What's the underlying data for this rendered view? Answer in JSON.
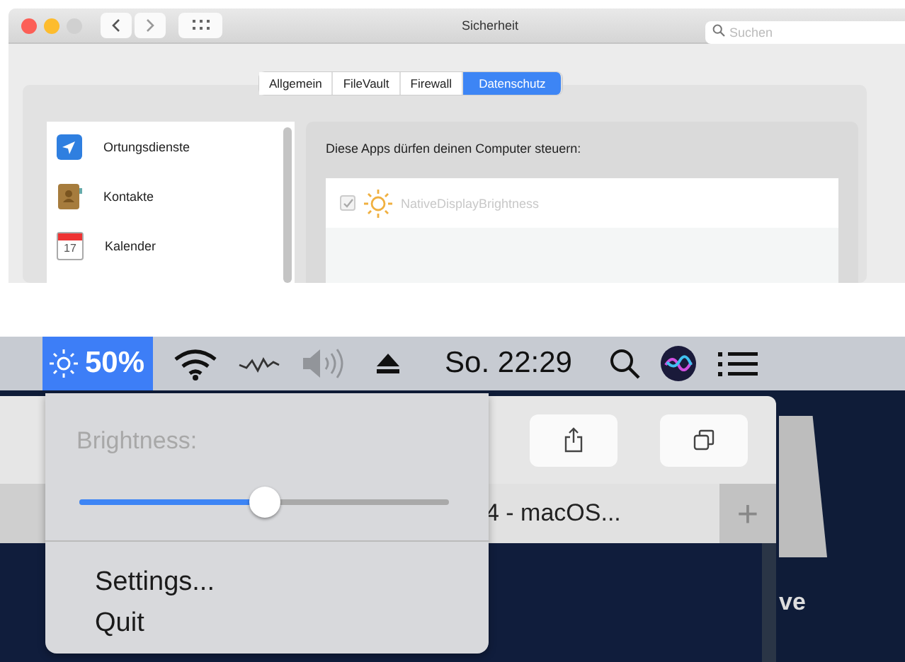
{
  "top_window": {
    "title": "Sicherheit",
    "search": {
      "placeholder": "Suchen"
    },
    "tabs": [
      {
        "label": "Allgemein",
        "selected": false
      },
      {
        "label": "FileVault",
        "selected": false
      },
      {
        "label": "Firewall",
        "selected": false
      },
      {
        "label": "Datenschutz",
        "selected": true
      }
    ],
    "sidebar": {
      "items": [
        {
          "kind": "location",
          "label": "Ortungsdienste"
        },
        {
          "kind": "contacts",
          "label": "Kontakte"
        },
        {
          "kind": "calendar",
          "label": "Kalender",
          "icon_text": "17"
        }
      ]
    },
    "panel": {
      "heading": "Diese Apps dürfen deinen Computer steuern:",
      "apps": [
        {
          "name": "NativeDisplayBrightness",
          "checked": true,
          "disabled": true
        }
      ]
    }
  },
  "menu_bar": {
    "brightness": {
      "reading": "50%",
      "selected": true
    },
    "volume": {
      "disabled": true
    },
    "clock": "So. 22:29"
  },
  "dropdown": {
    "label": "Brightness:",
    "slider": {
      "level": 0.5
    },
    "items": [
      "Settings...",
      "Quit"
    ]
  },
  "background_window": {
    "tab_title": "4 - macOS...",
    "new_tab": "+"
  },
  "desktop": {
    "text": "ve"
  }
}
